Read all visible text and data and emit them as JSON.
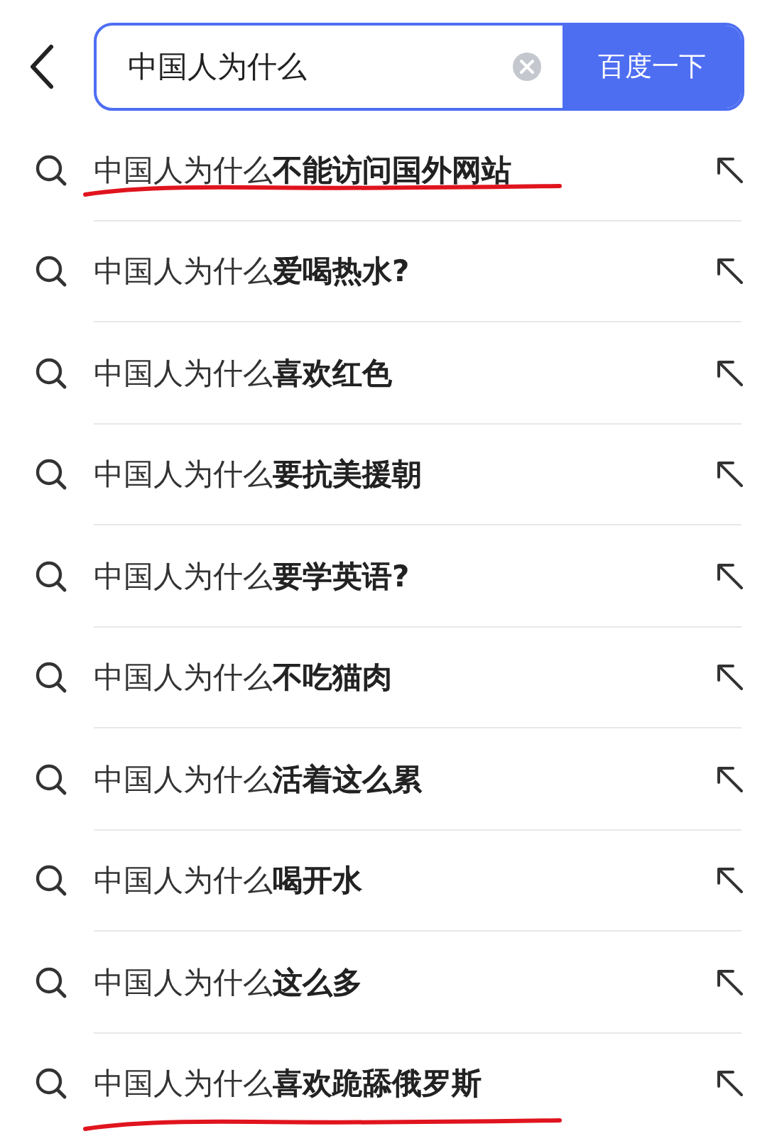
{
  "search": {
    "value": "中国人为什么",
    "button": "百度一下"
  },
  "suggestions": [
    {
      "text": "中国人为什么**不能访问国外网站**",
      "underlined": true
    },
    {
      "text": "中国人为什么**爱喝热水?**",
      "underlined": false
    },
    {
      "text": "中国人为什么**喜欢红色**",
      "underlined": false
    },
    {
      "text": "中国人为什么**要抗美援朝**",
      "underlined": false
    },
    {
      "text": "中国人为什么**要学英语?**",
      "underlined": false
    },
    {
      "text": "中国人为什么**不吃猫肉**",
      "underlined": false
    },
    {
      "text": "中国人为什么**活着这么累**",
      "underlined": false
    },
    {
      "text": "中国人为什么**喝开水**",
      "underlined": false
    },
    {
      "text": "中国人为什么**这么多**",
      "underlined": false
    },
    {
      "text": "中国人为什么**喜欢跪舔俄罗斯**",
      "underlined": true
    }
  ]
}
